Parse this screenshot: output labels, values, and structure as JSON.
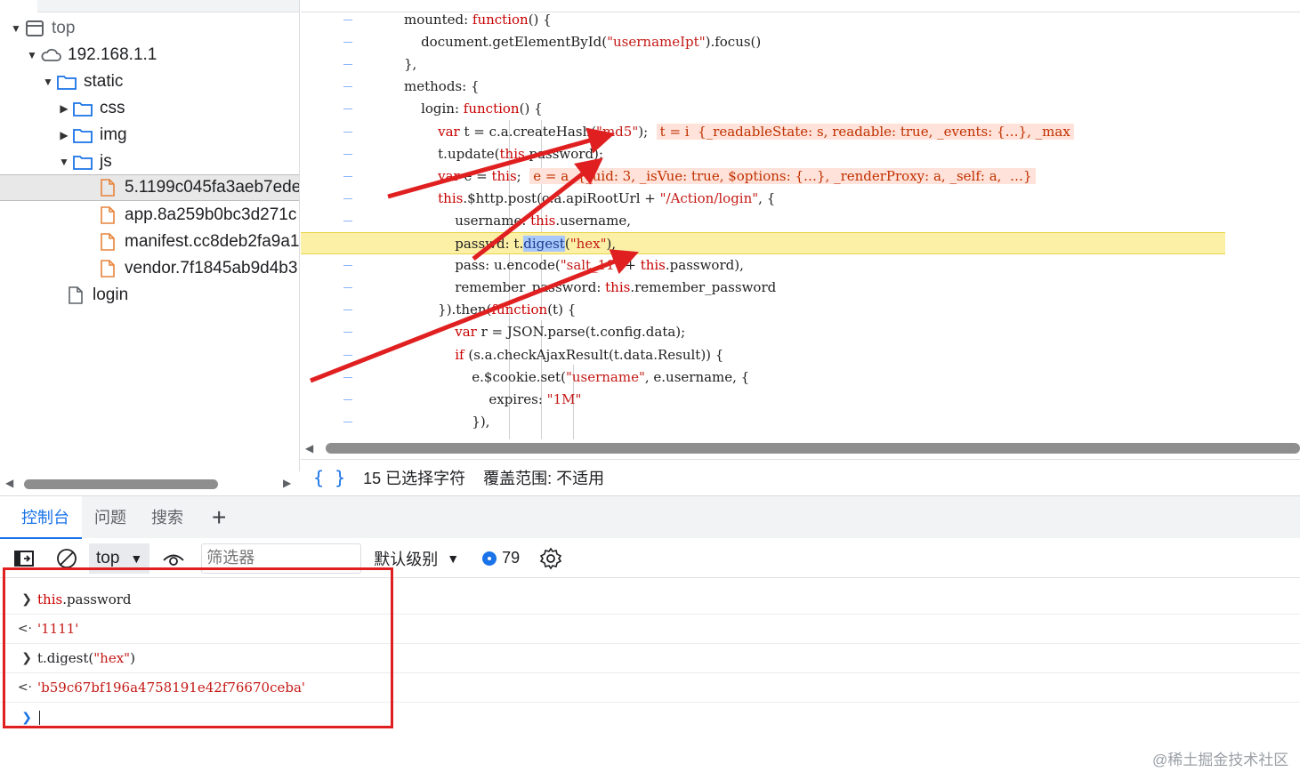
{
  "file_tree": {
    "root": "top",
    "host": "192.168.1.1",
    "folders": [
      "static",
      "css",
      "img",
      "js"
    ],
    "files": [
      "5.1199c045fa3aeb7ede",
      "app.8a259b0bc3d271c",
      "manifest.cc8deb2fa9a1",
      "vendor.7f1845ab9d4b3"
    ],
    "page": "login",
    "selected_file": "5.1199c045fa3aeb7ede"
  },
  "code": {
    "lines": [
      {
        "parts": [
          [
            "",
            "mounted: "
          ],
          [
            "kw",
            "function"
          ],
          [
            "",
            "() {"
          ]
        ]
      },
      {
        "parts": [
          [
            "",
            "    document.getElementById("
          ],
          [
            "str",
            "\"usernameIpt\""
          ],
          [
            "",
            ").focus()"
          ]
        ]
      },
      {
        "parts": [
          [
            "",
            "},"
          ]
        ]
      },
      {
        "parts": [
          [
            "",
            "methods: {"
          ]
        ]
      },
      {
        "parts": [
          [
            "",
            "    login: "
          ],
          [
            "kw",
            "function"
          ],
          [
            "",
            "() {"
          ]
        ]
      },
      {
        "parts": [
          [
            "kw",
            "        var"
          ],
          [
            "",
            " t = c.a.createHash("
          ],
          [
            "str",
            "\"md5\""
          ],
          [
            "",
            ");  "
          ],
          [
            "val",
            "t = i  {_readableState: s, readable: true, _events: {…}, _max"
          ]
        ]
      },
      {
        "parts": [
          [
            "",
            "        t.update("
          ],
          [
            "kw",
            "this"
          ],
          [
            "",
            ".password);"
          ]
        ]
      },
      {
        "parts": [
          [
            "kw",
            "        var"
          ],
          [
            "",
            " e = "
          ],
          [
            "kw",
            "this"
          ],
          [
            "",
            ";  "
          ],
          [
            "val",
            "e = a  {_uid: 3, _isVue: true, $options: {…}, _renderProxy: a, _self: a,  …}"
          ]
        ]
      },
      {
        "parts": [
          [
            "kw",
            "        this"
          ],
          [
            "",
            ".$http.post(o.a.apiRootUrl + "
          ],
          [
            "str",
            "\"/Action/login\""
          ],
          [
            "",
            ", {"
          ]
        ]
      },
      {
        "parts": [
          [
            "",
            "            username: "
          ],
          [
            "kw",
            "this"
          ],
          [
            "",
            ".username,"
          ]
        ]
      },
      {
        "parts": [
          [
            "",
            "            passwd: t."
          ],
          [
            "sel",
            "digest"
          ],
          [
            "",
            "("
          ],
          [
            "str",
            "\"hex\""
          ],
          [
            "",
            "),"
          ]
        ]
      },
      {
        "parts": [
          [
            "",
            "            pass: u.encode("
          ],
          [
            "str",
            "\"salt_11\""
          ],
          [
            "",
            " + "
          ],
          [
            "kw",
            "this"
          ],
          [
            "",
            ".password),"
          ]
        ]
      },
      {
        "parts": [
          [
            "",
            "            remember_password: "
          ],
          [
            "kw",
            "this"
          ],
          [
            "",
            ".remember_password"
          ]
        ]
      },
      {
        "parts": [
          [
            "",
            "        }).then("
          ],
          [
            "kw",
            "function"
          ],
          [
            "",
            "(t) {"
          ]
        ]
      },
      {
        "parts": [
          [
            "kw",
            "            var"
          ],
          [
            "",
            " r = JSON.parse(t.config.data);"
          ]
        ]
      },
      {
        "parts": [
          [
            "kw",
            "            if"
          ],
          [
            "",
            " (s.a.checkAjaxResult(t.data.Result)) {"
          ]
        ]
      },
      {
        "parts": [
          [
            "",
            "                e.$cookie.set("
          ],
          [
            "str",
            "\"username\""
          ],
          [
            "",
            ", e.username, {"
          ]
        ]
      },
      {
        "parts": [
          [
            "",
            "                    expires: "
          ],
          [
            "str",
            "\"1M\""
          ]
        ]
      },
      {
        "parts": [
          [
            "",
            "                }),"
          ]
        ]
      }
    ],
    "highlighted_line": 10
  },
  "status": {
    "selection": "15 已选择字符",
    "coverage": "覆盖范围: 不适用"
  },
  "drawer": {
    "tabs": [
      "控制台",
      "问题",
      "搜索"
    ],
    "active_tab": 0
  },
  "toolbar": {
    "context": "top",
    "filter_placeholder": "筛选器",
    "level": "默认级别",
    "message_count": "79"
  },
  "console": [
    {
      "kind": "input",
      "text": "this.password"
    },
    {
      "kind": "output",
      "text": "'1111'"
    },
    {
      "kind": "input",
      "text": "t.digest(\"hex\")"
    },
    {
      "kind": "output",
      "text": "'b59c67bf196a4758191e42f76670ceba'"
    }
  ],
  "watermark": "@稀土掘金技术社区",
  "colors": {
    "accent": "#1a73e8",
    "highlight_line": "#fbf0a6",
    "annotation_red": "#e02020",
    "breakpoint": "#d61f1f"
  }
}
